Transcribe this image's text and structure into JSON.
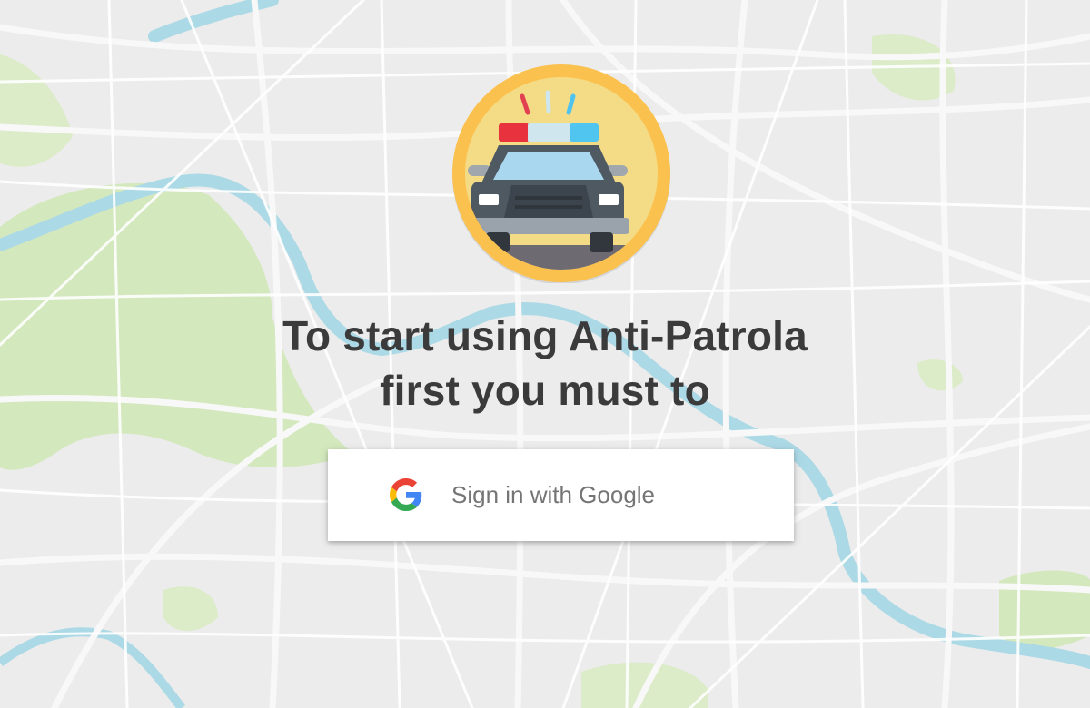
{
  "screen": {
    "headline_line1": "To start using Anti-Patrola",
    "headline_line2": "first you must to"
  },
  "signin_button": {
    "label": "Sign in with Google",
    "icon": "google-g-icon"
  },
  "logo": {
    "icon": "police-car-icon",
    "ring_color": "#fbc14f",
    "inner_color": "#f4dc86"
  },
  "colors": {
    "map_background": "#ececec",
    "map_park": "#cfe6b4",
    "map_water": "#aad8e6",
    "headline_text": "#3b3b3b",
    "button_text": "#757575"
  }
}
